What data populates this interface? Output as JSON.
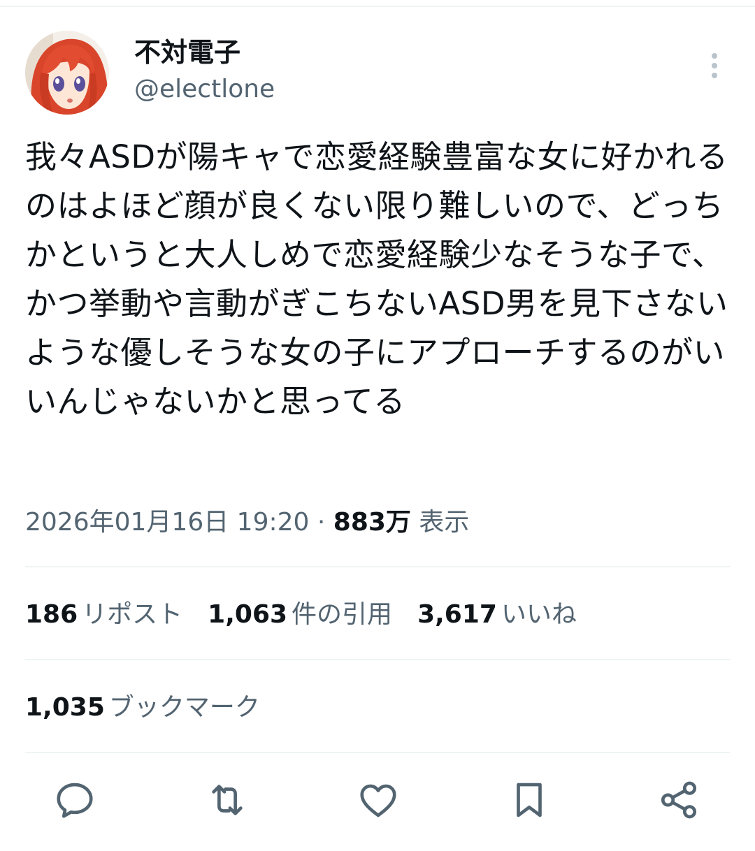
{
  "user": {
    "display_name": "不対電子",
    "handle": "@electlone"
  },
  "tweet": {
    "text": "我々ASDが陽キャで恋愛経験豊富な女に好かれるのはよほど顔が良くない限り難しいので、どっちかというと大人しめで恋愛経験少なそうな子で、かつ挙動や言動がぎこちないASD男を見下さないような優しそうな女の子にアプローチするのがいいんじゃないかと思ってる",
    "timestamp": "2026年01月16日 19:20",
    "separator": " · ",
    "views_count": "883万",
    "views_label": "表示"
  },
  "stats": {
    "reposts": {
      "count": "186",
      "label": "リポスト"
    },
    "quotes": {
      "count": "1,063",
      "label": "件の引用"
    },
    "likes": {
      "count": "3,617",
      "label": "いいね"
    },
    "bookmarks": {
      "count": "1,035",
      "label": "ブックマーク"
    }
  },
  "actions": {
    "icons": [
      "reply-icon",
      "repost-icon",
      "like-icon",
      "bookmark-icon",
      "share-icon"
    ]
  },
  "colors": {
    "text": "#0f1419",
    "secondary": "#536471",
    "divider": "#eff3f4",
    "avatar_hair": "#d9452b"
  }
}
